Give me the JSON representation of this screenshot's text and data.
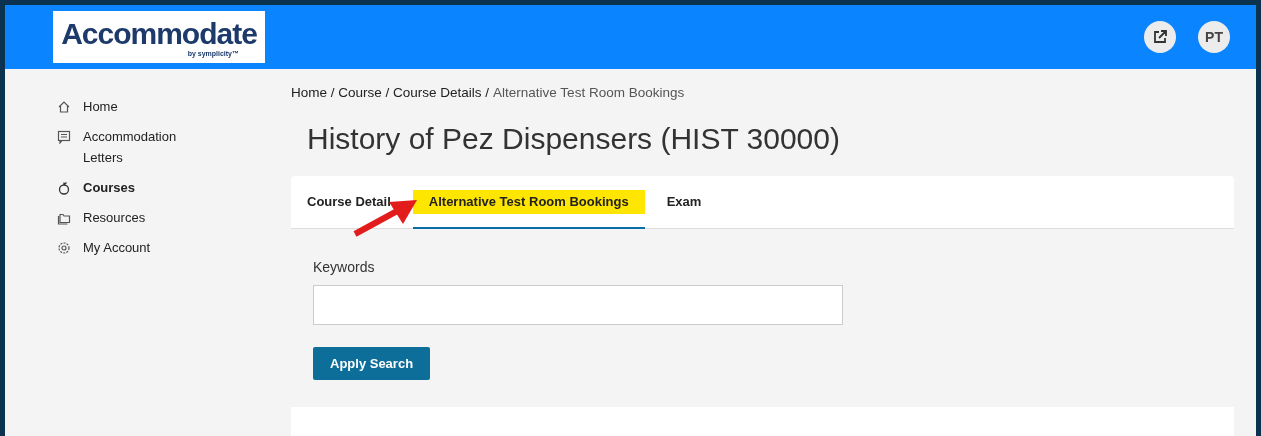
{
  "header": {
    "logo": {
      "name": "Accommodate",
      "byline": "by symplicity™"
    },
    "avatar": "PT"
  },
  "sidebar": {
    "items": [
      {
        "label": "Home",
        "selected": false
      },
      {
        "label": "Accommodation Letters",
        "selected": false
      },
      {
        "label": "Courses",
        "selected": true
      },
      {
        "label": "Resources",
        "selected": false
      },
      {
        "label": "My Account",
        "selected": false
      }
    ]
  },
  "breadcrumb": {
    "path": "Home / Course / Course Details /",
    "current": "Alternative Test Room Bookings"
  },
  "page_title": "History of Pez Dispensers (HIST 30000)",
  "tabs": [
    {
      "label": "Course Detail",
      "selected": false,
      "highlighted": false
    },
    {
      "label": "Alternative Test Room Bookings",
      "selected": true,
      "highlighted": true
    },
    {
      "label": "Exam",
      "selected": false,
      "highlighted": false
    }
  ],
  "search": {
    "label": "Keywords",
    "button": "Apply Search"
  }
}
